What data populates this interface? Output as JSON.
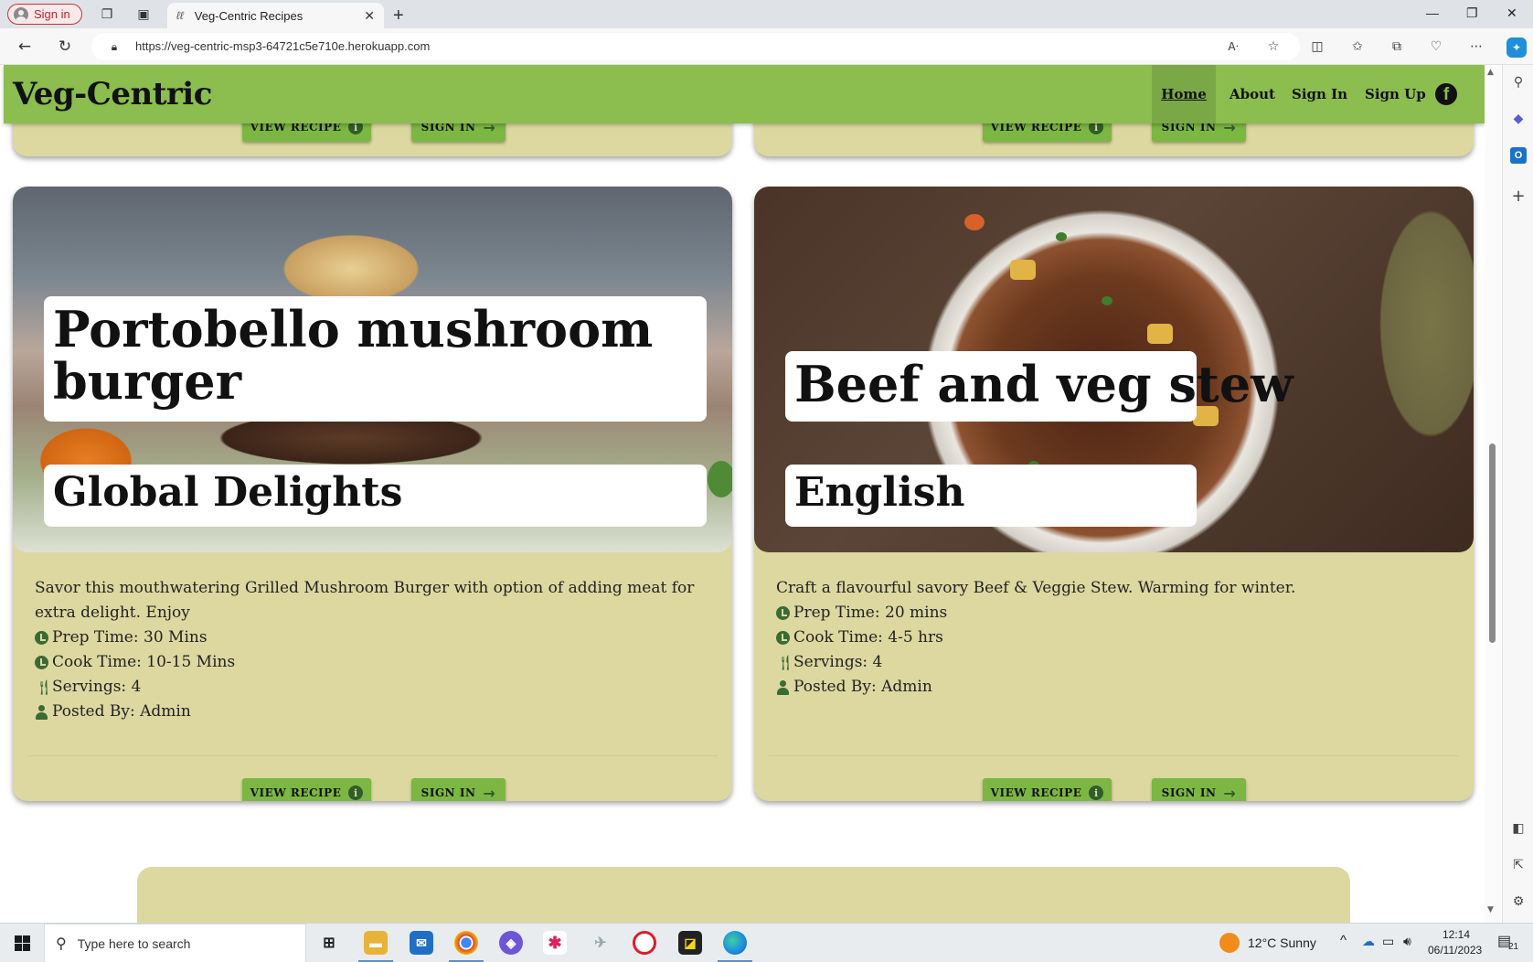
{
  "browser": {
    "profile_label": "Sign in",
    "tab_title": "Veg-Centric Recipes",
    "url": "https://veg-centric-msp3-64721c5e710e.herokuapp.com"
  },
  "nav": {
    "brand": "Veg-Centric",
    "items": [
      {
        "label": "Home",
        "active": true
      },
      {
        "label": "About"
      },
      {
        "label": "Sign In"
      },
      {
        "label": "Sign Up"
      }
    ],
    "accent_color": "#8bbd4f"
  },
  "buttons": {
    "view_recipe": "VIEW RECIPE",
    "sign_in": "SIGN IN",
    "info_glyph": "i",
    "arrow_glyph": "→"
  },
  "cards": [
    {
      "title": "Portobello mushroom burger",
      "cuisine": "Global Delights",
      "description": "Savor this mouthwatering Grilled Mushroom Burger with option of adding meat for extra delight. Enjoy",
      "prep": "Prep Time: 30 Mins",
      "cook": "Cook Time: 10-15 Mins",
      "servings": "Servings: 4",
      "posted": "Posted By: Admin"
    },
    {
      "title": "Beef and veg stew",
      "cuisine": "English",
      "description": "Craft a flavourful savory Beef & Veggie Stew. Warming for winter.",
      "prep": "Prep Time: 20 mins",
      "cook": "Cook Time: 4-5 hrs",
      "servings": "Servings: 4",
      "posted": "Posted By: Admin"
    }
  ],
  "taskbar": {
    "search_placeholder": "Type here to search",
    "weather": "12°C  Sunny",
    "time": "12:14",
    "date": "06/11/2023",
    "notification_count": "21"
  }
}
